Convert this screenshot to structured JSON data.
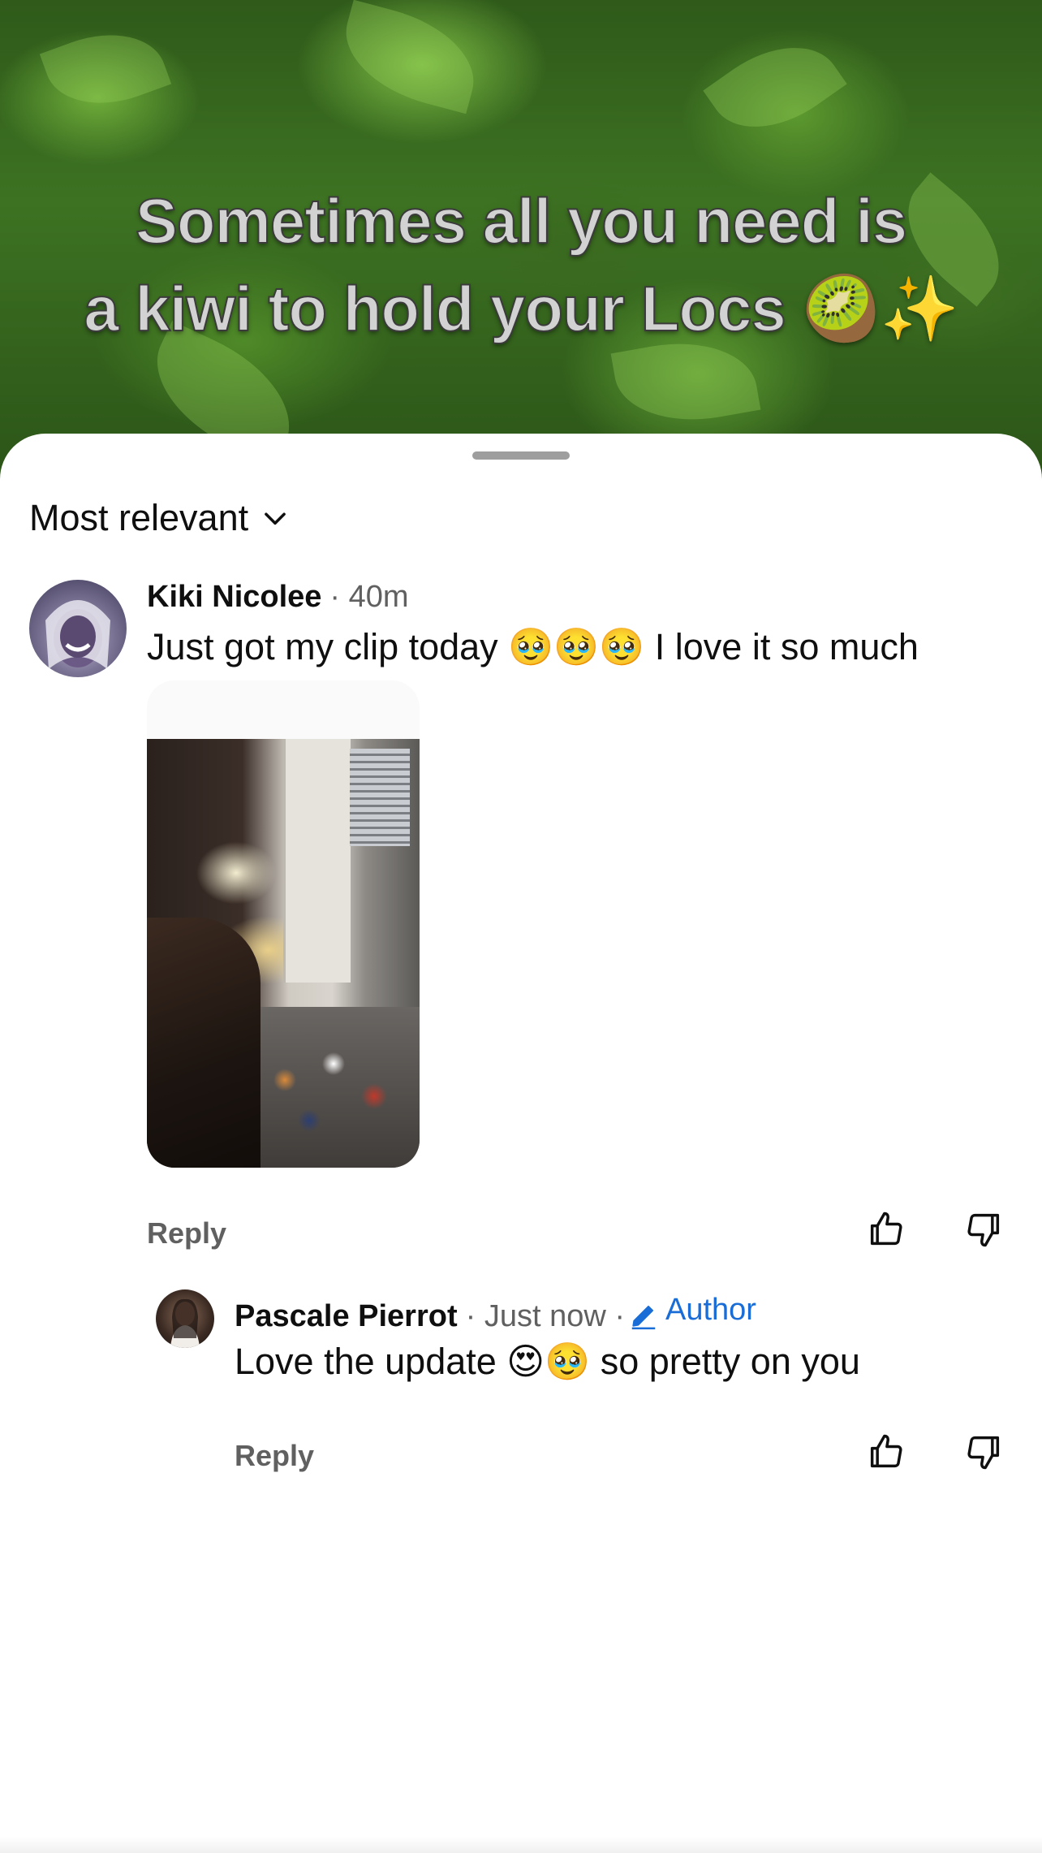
{
  "video": {
    "caption_line1": "Sometimes all you need is",
    "caption_line2": "a kiwi to hold your Locs 🥝✨"
  },
  "sheet": {
    "sort_label": "Most relevant"
  },
  "comments": [
    {
      "author": "Kiki Nicolee",
      "time": "· 40m",
      "text": "Just got my clip today 🥹🥹🥹 I love it so much",
      "reply_label": "Reply",
      "has_image": true
    }
  ],
  "replies": [
    {
      "author": "Pascale Pierrot",
      "time": "· Just now ·",
      "badge": "Author",
      "text": "Love the update 😍🥹 so pretty on you",
      "reply_label": "Reply"
    }
  ],
  "colors": {
    "accent_blue": "#1a6dd6",
    "meta_gray": "#606060",
    "text_dark": "#0f0f0f"
  },
  "icons": {
    "like": "thumbs-up-icon",
    "dislike": "thumbs-down-icon",
    "sort": "chevron-down-icon",
    "author_badge": "pencil-icon"
  }
}
